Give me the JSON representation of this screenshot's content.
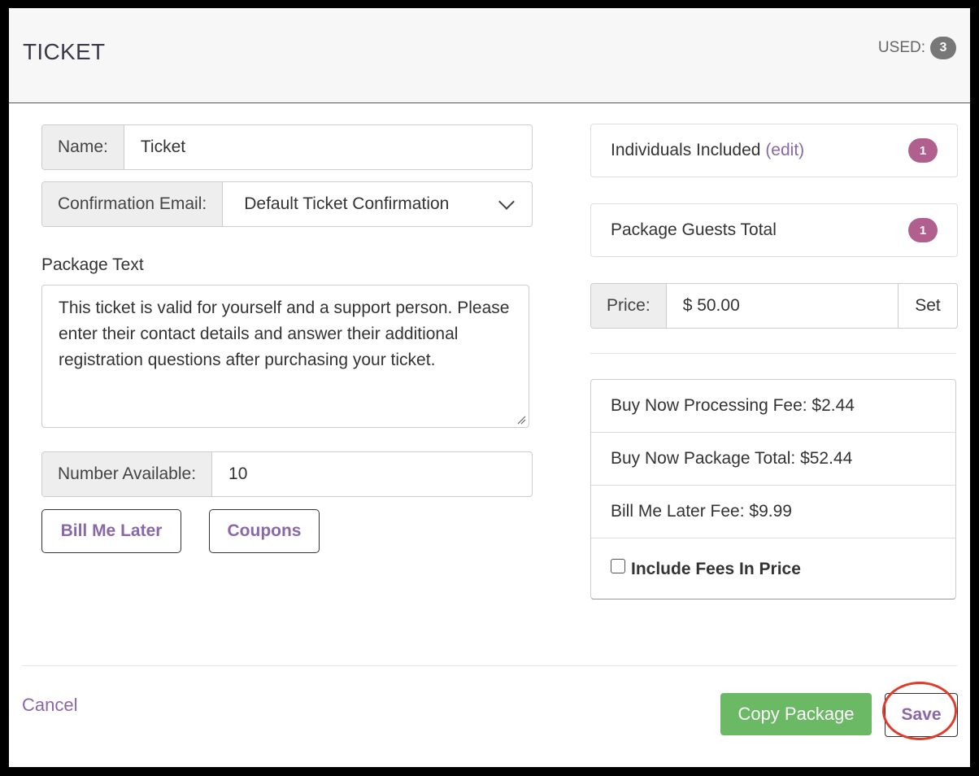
{
  "header": {
    "title": "TICKET",
    "used_label": "USED:",
    "used_count": "3"
  },
  "form": {
    "name_label": "Name:",
    "name_value": "Ticket",
    "confirmation_label": "Confirmation Email:",
    "confirmation_value": "Default Ticket Confirmation",
    "package_text_label": "Package Text",
    "package_text_value": "This ticket is valid for yourself and a support person. Please enter their contact details and answer their additional registration questions after purchasing your ticket.",
    "number_available_label": "Number Available:",
    "number_available_value": "10",
    "bill_me_later_button": "Bill Me Later",
    "coupons_button": "Coupons"
  },
  "summary": {
    "individuals_label": "Individuals Included",
    "individuals_edit": "(edit)",
    "individuals_count": "1",
    "guests_label": "Package Guests Total",
    "guests_count": "1",
    "price_label": "Price:",
    "price_value": "$ 50.00",
    "set_button": "Set"
  },
  "fees": {
    "processing_fee": "Buy Now Processing Fee: $2.44",
    "package_total": "Buy Now Package Total: $52.44",
    "bill_later_fee": "Bill Me Later Fee: $9.99",
    "include_fees_label": "Include Fees In Price",
    "include_fees_checked": false
  },
  "footer": {
    "cancel": "Cancel",
    "copy_package": "Copy Package",
    "save": "Save"
  },
  "colors": {
    "accent_purple": "#8a68a8",
    "badge_pink": "#b05f8e",
    "copy_green": "#6bb865",
    "highlight_red": "#e03b2b"
  }
}
